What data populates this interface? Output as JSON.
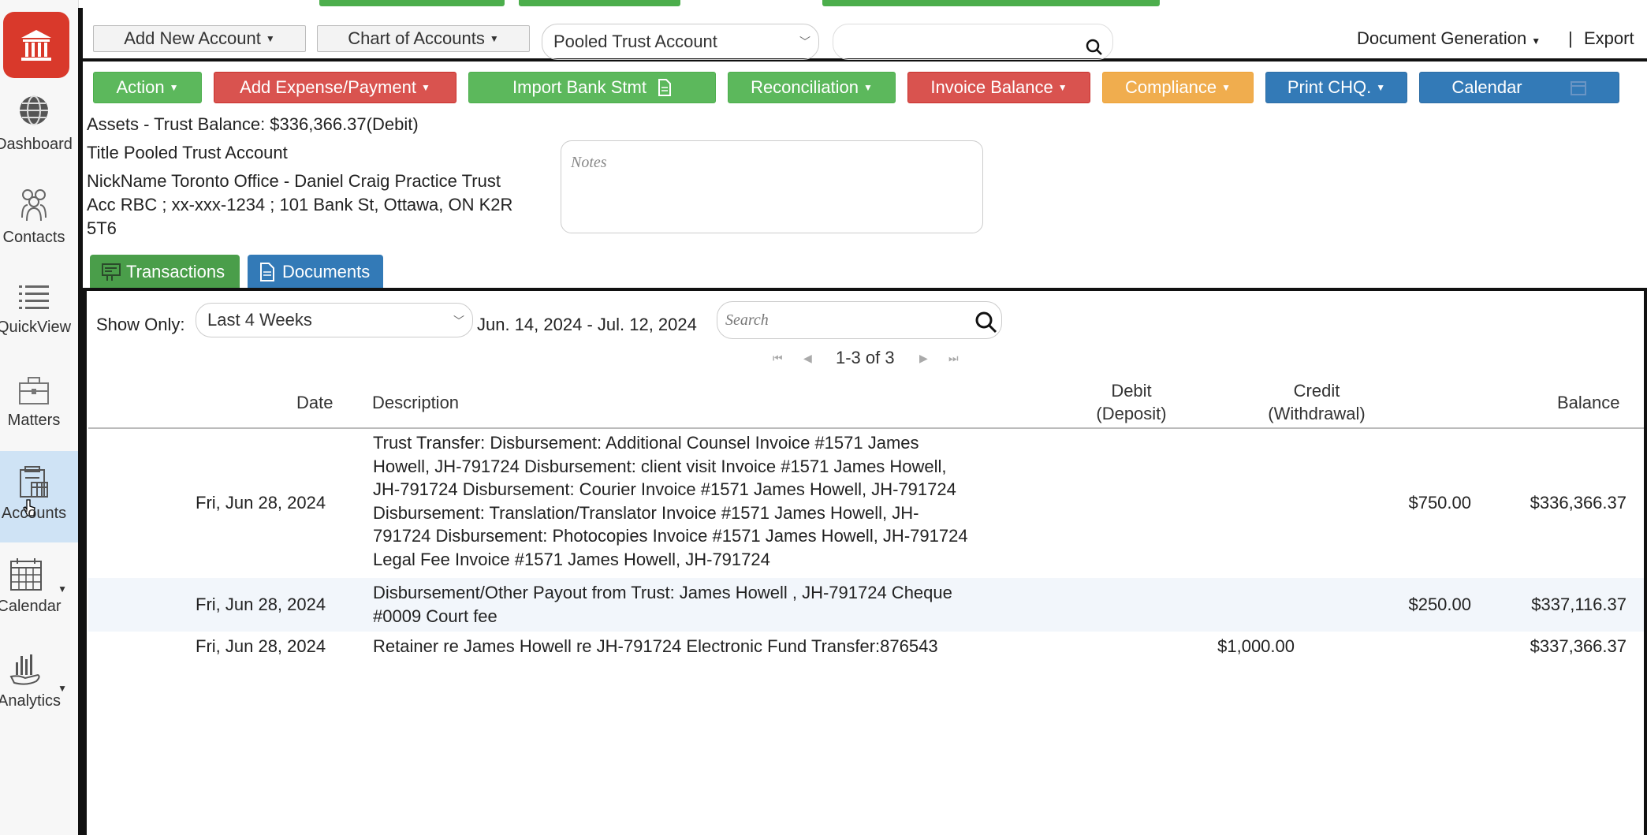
{
  "sidebar": {
    "items": [
      {
        "label": "Dashboard",
        "icon": "globe-icon"
      },
      {
        "label": "Contacts",
        "icon": "people-icon"
      },
      {
        "label": "QuickView",
        "icon": "list-icon"
      },
      {
        "label": "Matters",
        "icon": "briefcase-icon"
      },
      {
        "label": "Accounts",
        "icon": "ledger-icon"
      },
      {
        "label": "Calendar",
        "icon": "calendar-icon"
      },
      {
        "label": "Analytics",
        "icon": "analytics-icon"
      }
    ]
  },
  "toolbar": {
    "add_new_account": "Add New Account",
    "chart_of_accounts": "Chart of Accounts",
    "account_select": "Pooled Trust Account",
    "search_value": "",
    "document_generation": "Document Generation",
    "separator": "|",
    "export": "Export"
  },
  "actions": {
    "action": "Action",
    "add_expense": "Add Expense/Payment",
    "import_bank": "Import Bank Stmt",
    "reconciliation": "Reconciliation",
    "invoice_balance": "Invoice Balance",
    "compliance": "Compliance",
    "print_chq": "Print CHQ.",
    "calendar": "Calendar"
  },
  "account_info": {
    "balance_line": "Assets - Trust Balance: $336,366.37(Debit)",
    "title_line": "Title Pooled Trust Account",
    "nickname_line": "NickName Toronto Office - Daniel Craig Practice Trust",
    "acc_line1": "Acc RBC ; xx-xxx-1234 ; 101 Bank St, Ottawa, ON K2R",
    "acc_line2": "5T6",
    "notes_placeholder": "Notes"
  },
  "tabs": {
    "transactions": "Transactions",
    "documents": "Documents"
  },
  "filters": {
    "show_only_label": "Show Only:",
    "range": "Last 4 Weeks",
    "date_range": "Jun. 14, 2024 - Jul. 12, 2024",
    "search_placeholder": "Search"
  },
  "pagination": {
    "text": "1-3 of 3"
  },
  "table": {
    "headers": {
      "date": "Date",
      "description": "Description",
      "debit_1": "Debit",
      "debit_2": "(Deposit)",
      "credit_1": "Credit",
      "credit_2": "(Withdrawal)",
      "balance": "Balance"
    },
    "rows": [
      {
        "date": "Fri, Jun 28, 2024",
        "desc": [
          "Trust Transfer: Disbursement: Additional Counsel Invoice #1571 James",
          "Howell, JH-791724 Disbursement: client visit Invoice #1571 James Howell,",
          "JH-791724 Disbursement: Courier Invoice #1571 James Howell, JH-791724",
          "Disbursement: Translation/Translator Invoice #1571 James Howell, JH-",
          "791724 Disbursement: Photocopies Invoice #1571 James Howell, JH-791724",
          "Legal Fee Invoice #1571 James Howell, JH-791724"
        ],
        "debit": "",
        "credit": "$750.00",
        "balance": "$336,366.37"
      },
      {
        "date": "Fri, Jun 28, 2024",
        "desc": [
          "Disbursement/Other Payout from Trust: James Howell , JH-791724 Cheque",
          "#0009 Court fee"
        ],
        "debit": "",
        "credit": "$250.00",
        "balance": "$337,116.37"
      },
      {
        "date": "Fri, Jun 28, 2024",
        "desc": [
          "Retainer re James Howell re JH-791724 Electronic Fund Transfer:876543"
        ],
        "debit": "$1,000.00",
        "credit": "",
        "balance": "$337,366.37"
      }
    ]
  },
  "colors": {
    "green": "#5cb85c",
    "red": "#d9534f",
    "orange": "#f0ad4e",
    "blue": "#337ab7",
    "logo": "#d9392b",
    "active_nav": "#cfe3f5"
  }
}
